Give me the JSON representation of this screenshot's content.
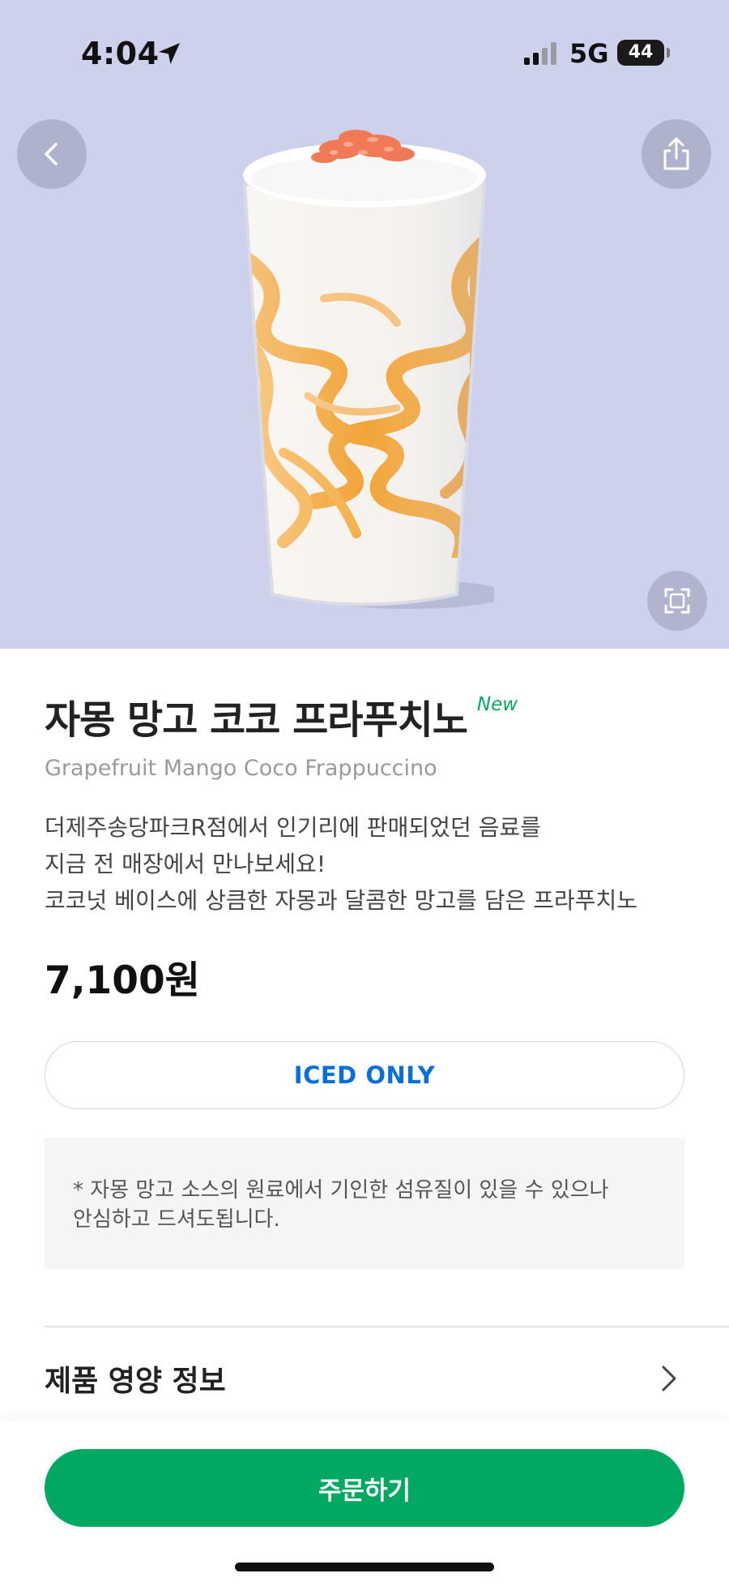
{
  "status_bar": {
    "time": "4:04",
    "network": "5G",
    "battery": "44",
    "icons": [
      "location-arrow-icon",
      "cellular-signal-icon",
      "battery-icon"
    ]
  },
  "hero": {
    "background_color": "#cdd1ec",
    "back_icon": "chevron-left-icon",
    "share_icon": "share-icon",
    "expand_icon": "fullscreen-icon",
    "image": "grapefruit-mango-coco-frappuccino"
  },
  "product": {
    "name_ko": "자몽 망고 코코 프라푸치노",
    "badge": "New",
    "name_en": "Grapefruit Mango Coco Frappuccino",
    "description": [
      "더제주송당파크R점에서 인기리에 판매되었던 음료를",
      "지금 전 매장에서 만나보세요!",
      "코코넛 베이스에 상큼한 자몽과 달콤한 망고를 담은 프라푸치노"
    ],
    "price": "7,100원",
    "temperature_option": "ICED ONLY",
    "notice": [
      "* 자몽 망고 소스의 원료에서 기인한 섬유질이 있을 수 있으나",
      "안심하고 드셔도됩니다."
    ]
  },
  "nutrition": {
    "label": "제품 영양 정보",
    "icon": "chevron-right-icon"
  },
  "order": {
    "label": "주문하기",
    "color": "#00a862"
  },
  "colors": {
    "accent_green": "#00a862",
    "link_blue": "#0a6fd8"
  }
}
